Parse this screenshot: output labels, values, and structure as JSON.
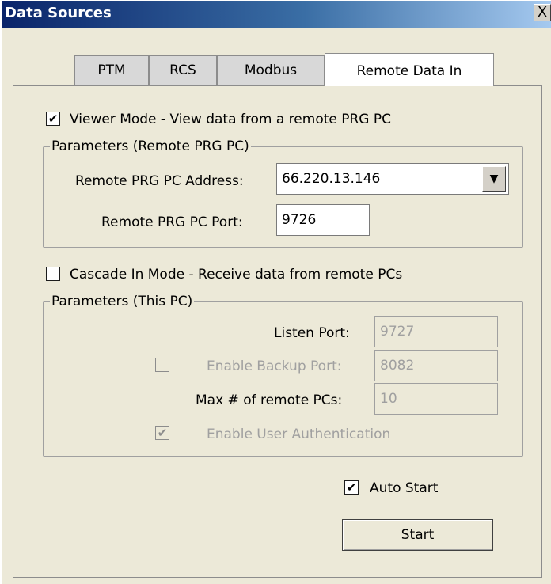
{
  "window": {
    "title": "Data Sources",
    "close_symbol": "X"
  },
  "tabs": [
    {
      "label": "PTM"
    },
    {
      "label": "RCS"
    },
    {
      "label": "Modbus"
    },
    {
      "label": "Remote Data In",
      "active": true
    }
  ],
  "viewer_mode": {
    "checked": true,
    "check_mark": "✔",
    "label": "Viewer Mode - View data from a remote PRG PC",
    "group_title": "Parameters (Remote PRG PC)",
    "address_label": "Remote PRG PC Address:",
    "address_value": "66.220.13.146",
    "port_label": "Remote PRG PC Port:",
    "port_value": "9726"
  },
  "cascade_mode": {
    "checked": false,
    "label": "Cascade In Mode - Receive data from remote PCs",
    "group_title": "Parameters (This PC)",
    "listen_port_label": "Listen Port:",
    "listen_port_value": "9727",
    "backup_label": "Enable Backup Port:",
    "backup_checked": false,
    "backup_port_value": "8082",
    "max_label": "Max # of remote PCs:",
    "max_value": "10",
    "auth_label": "Enable User Authentication",
    "auth_checked": true,
    "auth_check_mark": "✔"
  },
  "auto_start": {
    "checked": true,
    "check_mark": "✔",
    "label": "Auto Start"
  },
  "start_button": {
    "label": "Start"
  }
}
